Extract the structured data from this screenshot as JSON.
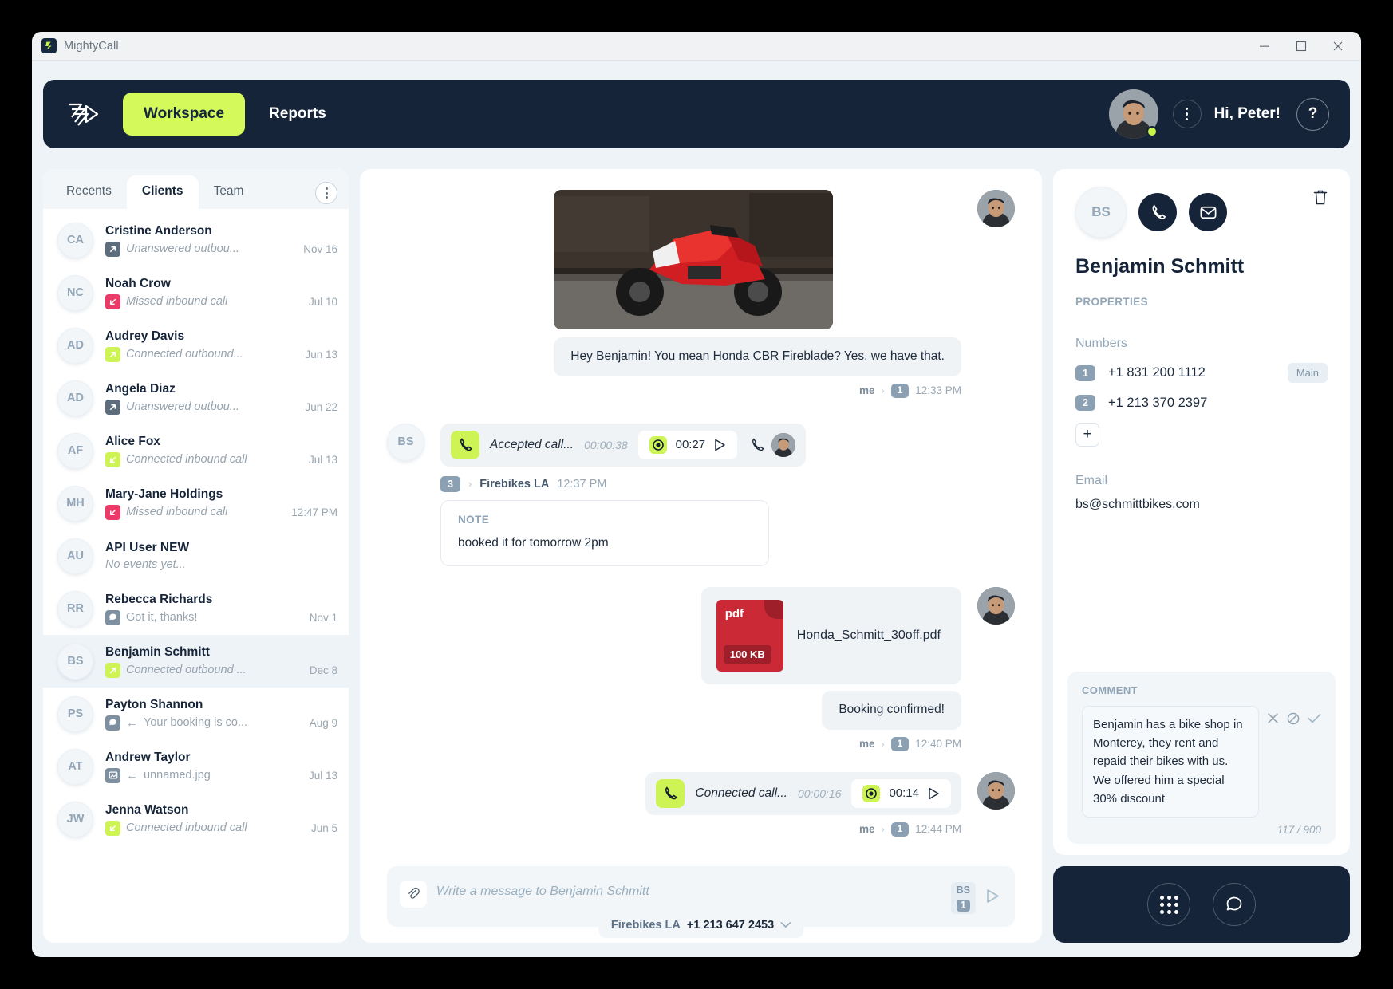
{
  "window": {
    "title": "MightyCall",
    "minimize_icon": "minimize-icon",
    "maximize_icon": "maximize-icon",
    "close_icon": "close-icon"
  },
  "topnav": {
    "logo_icon": "mightycall-logo-icon",
    "tabs": [
      {
        "label": "Workspace",
        "active": true
      },
      {
        "label": "Reports",
        "active": false
      }
    ],
    "greeting": "Hi, Peter!",
    "help_label": "?",
    "kebab_icon": "kebab-menu-icon",
    "avatar_icon": "user-avatar"
  },
  "sidebar": {
    "tabs": [
      {
        "label": "Recents",
        "active": false
      },
      {
        "label": "Clients",
        "active": true
      },
      {
        "label": "Team",
        "active": false
      }
    ],
    "clients": [
      {
        "initials": "CA",
        "name": "Cristine Anderson",
        "event": "Unanswered outbou...",
        "icon": "outbound-arrow-icon",
        "icon_color": "grey",
        "date": "Nov 16",
        "italic": true,
        "selected": false
      },
      {
        "initials": "NC",
        "name": "Noah Crow",
        "event": "Missed inbound call",
        "icon": "inbound-arrow-icon",
        "icon_color": "red",
        "date": "Jul 10",
        "italic": true,
        "selected": false
      },
      {
        "initials": "AD",
        "name": "Audrey Davis",
        "event": "Connected outbound...",
        "icon": "outbound-arrow-icon",
        "icon_color": "lime",
        "date": "Jun 13",
        "italic": true,
        "selected": false
      },
      {
        "initials": "AD",
        "name": "Angela Diaz",
        "event": "Unanswered outbou...",
        "icon": "outbound-arrow-icon",
        "icon_color": "grey",
        "date": "Jun 22",
        "italic": true,
        "selected": false
      },
      {
        "initials": "AF",
        "name": "Alice Fox",
        "event": "Connected inbound call",
        "icon": "inbound-arrow-icon",
        "icon_color": "lime",
        "date": "Jul 13",
        "italic": true,
        "selected": false
      },
      {
        "initials": "MH",
        "name": "Mary-Jane Holdings",
        "event": "Missed inbound call",
        "icon": "inbound-arrow-icon",
        "icon_color": "red",
        "date": "12:47 PM",
        "italic": true,
        "selected": false
      },
      {
        "initials": "AU",
        "name": "API User NEW",
        "event": "No events yet...",
        "icon": "",
        "icon_color": "",
        "date": "",
        "italic": true,
        "selected": false
      },
      {
        "initials": "RR",
        "name": "Rebecca Richards",
        "event": "Got it, thanks!",
        "icon": "message-bubble-icon",
        "icon_color": "slate",
        "date": "Nov 1",
        "italic": false,
        "selected": false
      },
      {
        "initials": "BS",
        "name": "Benjamin Schmitt",
        "event": "Connected outbound ...",
        "icon": "outbound-arrow-icon",
        "icon_color": "lime",
        "date": "Dec 8",
        "italic": true,
        "selected": true
      },
      {
        "initials": "PS",
        "name": "Payton Shannon",
        "event": "Your booking is co...",
        "icon": "message-bubble-icon",
        "icon_color": "slate",
        "date": "Aug 9",
        "italic": false,
        "inbound_arrow": true,
        "selected": false
      },
      {
        "initials": "AT",
        "name": "Andrew Taylor",
        "event": "unnamed.jpg",
        "icon": "image-attachment-icon",
        "icon_color": "slate",
        "date": "Jul 13",
        "italic": false,
        "inbound_arrow": true,
        "selected": false
      },
      {
        "initials": "JW",
        "name": "Jenna Watson",
        "event": "Connected inbound call",
        "icon": "inbound-arrow-icon",
        "icon_color": "lime",
        "date": "Jun 5",
        "italic": true,
        "selected": false
      }
    ]
  },
  "chat": {
    "messages": [
      {
        "type": "photo_text",
        "photo_alt": "red-motorcycle-photo",
        "text": "Hey Benjamin! You mean Honda CBR Fireblade? Yes, we have that.",
        "who": "me",
        "badge": "1",
        "time": "12:33 PM"
      },
      {
        "type": "call_in",
        "avatar_initials": "BS",
        "label": "Accepted call...",
        "duration": "00:00:38",
        "rec_time": "00:27",
        "record_icon": "record-icon",
        "play_icon": "play-icon",
        "phone_icon": "phone-icon"
      },
      {
        "type": "note",
        "badge": "3",
        "org": "Firebikes LA",
        "time": "12:37 PM",
        "note_label": "NOTE",
        "note_text": "booked it for tomorrow 2pm"
      },
      {
        "type": "file",
        "file_kind": "pdf",
        "file_size": "100 KB",
        "file_name": "Honda_Schmitt_30off.pdf"
      },
      {
        "type": "text",
        "text": "Booking confirmed!",
        "who": "me",
        "badge": "1",
        "time": "12:40 PM"
      },
      {
        "type": "call_out",
        "label": "Connected call...",
        "duration": "00:00:16",
        "rec_time": "00:14",
        "who": "me",
        "badge": "1",
        "time": "12:44 PM"
      }
    ],
    "composer": {
      "placeholder": "Write a message to Benjamin Schmitt",
      "attach_icon": "paperclip-icon",
      "send_icon": "send-icon",
      "chip_initials": "BS",
      "chip_number": "1",
      "from_org": "Firebikes LA",
      "from_number": "+1 213 647 2453",
      "chevron_icon": "chevron-down-icon"
    }
  },
  "contact": {
    "initials": "BS",
    "name": "Benjamin Schmitt",
    "call_icon": "phone-icon",
    "mail_icon": "envelope-icon",
    "trash_icon": "trash-icon",
    "properties_label": "PROPERTIES",
    "numbers_label": "Numbers",
    "numbers": [
      {
        "index": "1",
        "value": "+1 831 200 1112",
        "tag": "Main"
      },
      {
        "index": "2",
        "value": "+1 213 370 2397",
        "tag": ""
      }
    ],
    "add_number_label": "+",
    "email_label": "Email",
    "email": "bs@schmittbikes.com",
    "comment": {
      "label": "COMMENT",
      "text": "Benjamin has a bike shop in Monterey, they rent and repaid their bikes with us. We offered him a special 30% discount",
      "counter": "117 / 900",
      "clear_icon": "close-icon",
      "cancel_icon": "ban-icon",
      "confirm_icon": "check-icon"
    }
  },
  "dialer": {
    "keypad_icon": "dialpad-icon",
    "chat_icon": "chat-bubble-icon"
  }
}
